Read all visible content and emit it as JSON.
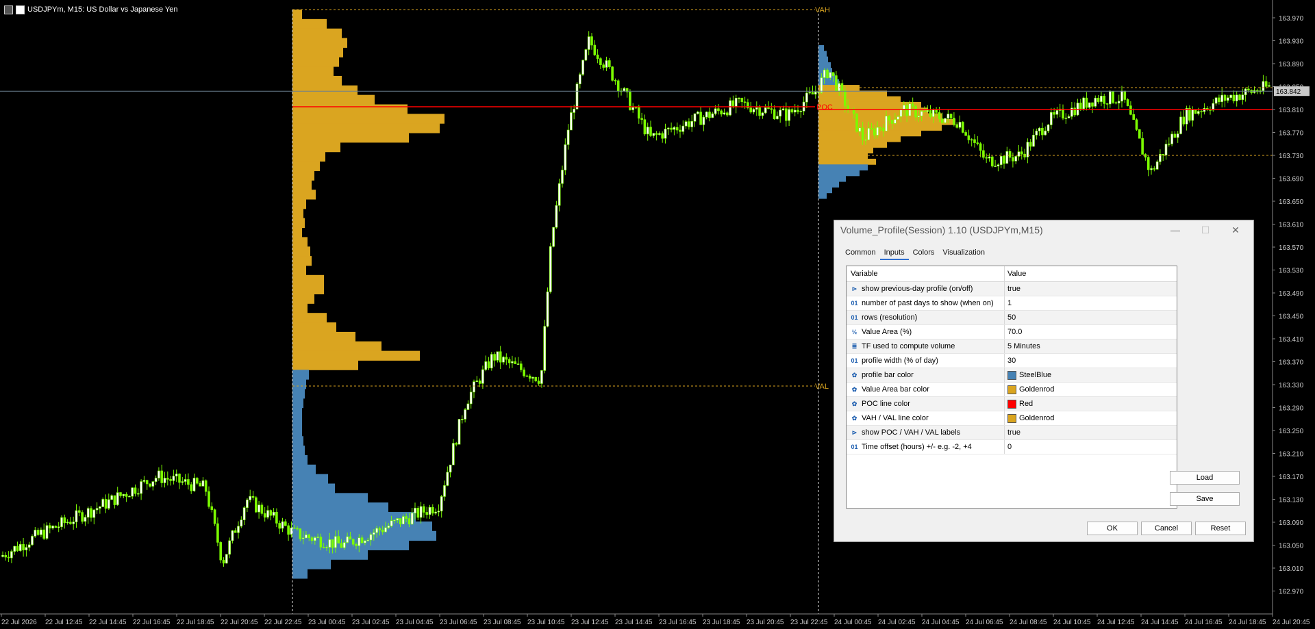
{
  "window": {
    "title": "USDJPYm, M15:  US Dollar vs Japanese Yen"
  },
  "colors": {
    "bull": "#7CFC00",
    "bear": "#ffffff",
    "steelblue": "#4682B4",
    "goldenrod": "#DAA520",
    "poc": "#ff0000",
    "grid_line": "#707070"
  },
  "price_axis": [
    "163.970",
    "163.930",
    "163.890",
    "163.850",
    "163.810",
    "163.770",
    "163.730",
    "163.690",
    "163.650",
    "163.610",
    "163.570",
    "163.530",
    "163.490",
    "163.450",
    "163.410",
    "163.370",
    "163.330",
    "163.290",
    "163.250",
    "163.210",
    "163.170",
    "163.130",
    "163.090",
    "163.050",
    "163.010",
    "162.970"
  ],
  "current_price": "163.842",
  "time_axis": [
    "22 Jul 2026",
    "22 Jul 12:45",
    "22 Jul 14:45",
    "22 Jul 16:45",
    "22 Jul 18:45",
    "22 Jul 20:45",
    "22 Jul 22:45",
    "23 Jul 00:45",
    "23 Jul 02:45",
    "23 Jul 04:45",
    "23 Jul 06:45",
    "23 Jul 08:45",
    "23 Jul 10:45",
    "23 Jul 12:45",
    "23 Jul 14:45",
    "23 Jul 16:45",
    "23 Jul 18:45",
    "23 Jul 20:45",
    "23 Jul 22:45",
    "24 Jul 00:45",
    "24 Jul 02:45",
    "24 Jul 04:45",
    "24 Jul 06:45",
    "24 Jul 08:45",
    "24 Jul 10:45",
    "24 Jul 12:45",
    "24 Jul 14:45",
    "24 Jul 16:45",
    "24 Jul 18:45",
    "24 Jul 20:45"
  ],
  "labels": {
    "vah": "VAH",
    "val": "VAL",
    "poc": "POC"
  },
  "dialog": {
    "title": "Volume_Profile(Session) 1.10 (USDJPYm,M15)",
    "tabs": [
      "Common",
      "Inputs",
      "Colors",
      "Visualization"
    ],
    "active_tab": "Inputs",
    "columns": {
      "variable": "Variable",
      "value": "Value"
    },
    "rows": [
      {
        "icon": "bool-icon",
        "glyph": "⊳",
        "variable": "show previous-day profile (on/off)",
        "value": "true"
      },
      {
        "icon": "int-icon",
        "glyph": "01",
        "variable": "number of past days to show (when on)",
        "value": "1"
      },
      {
        "icon": "int-icon",
        "glyph": "01",
        "variable": "rows (resolution)",
        "value": "50"
      },
      {
        "icon": "double-icon",
        "glyph": "½",
        "variable": "Value Area (%)",
        "value": "70.0"
      },
      {
        "icon": "enum-icon",
        "glyph": "≣",
        "variable": "TF used to compute volume",
        "value": "5 Minutes"
      },
      {
        "icon": "int-icon",
        "glyph": "01",
        "variable": "profile width (% of day)",
        "value": "30"
      },
      {
        "icon": "color-icon",
        "glyph": "✿",
        "variable": "profile bar color",
        "value": "SteelBlue",
        "swatch": "#4682B4"
      },
      {
        "icon": "color-icon",
        "glyph": "✿",
        "variable": "Value Area bar color",
        "value": "Goldenrod",
        "swatch": "#DAA520"
      },
      {
        "icon": "color-icon",
        "glyph": "✿",
        "variable": "POC line color",
        "value": "Red",
        "swatch": "#ff0000"
      },
      {
        "icon": "color-icon",
        "glyph": "✿",
        "variable": "VAH / VAL line color",
        "value": "Goldenrod",
        "swatch": "#DAA520"
      },
      {
        "icon": "bool-icon",
        "glyph": "⊳",
        "variable": "show POC / VAH / VAL labels",
        "value": "true"
      },
      {
        "icon": "int-icon",
        "glyph": "01",
        "variable": "Time offset (hours) +/- e.g. -2, +4",
        "value": "0"
      }
    ],
    "buttons": {
      "load": "Load",
      "save": "Save",
      "ok": "OK",
      "cancel": "Cancel",
      "reset": "Reset"
    }
  }
}
